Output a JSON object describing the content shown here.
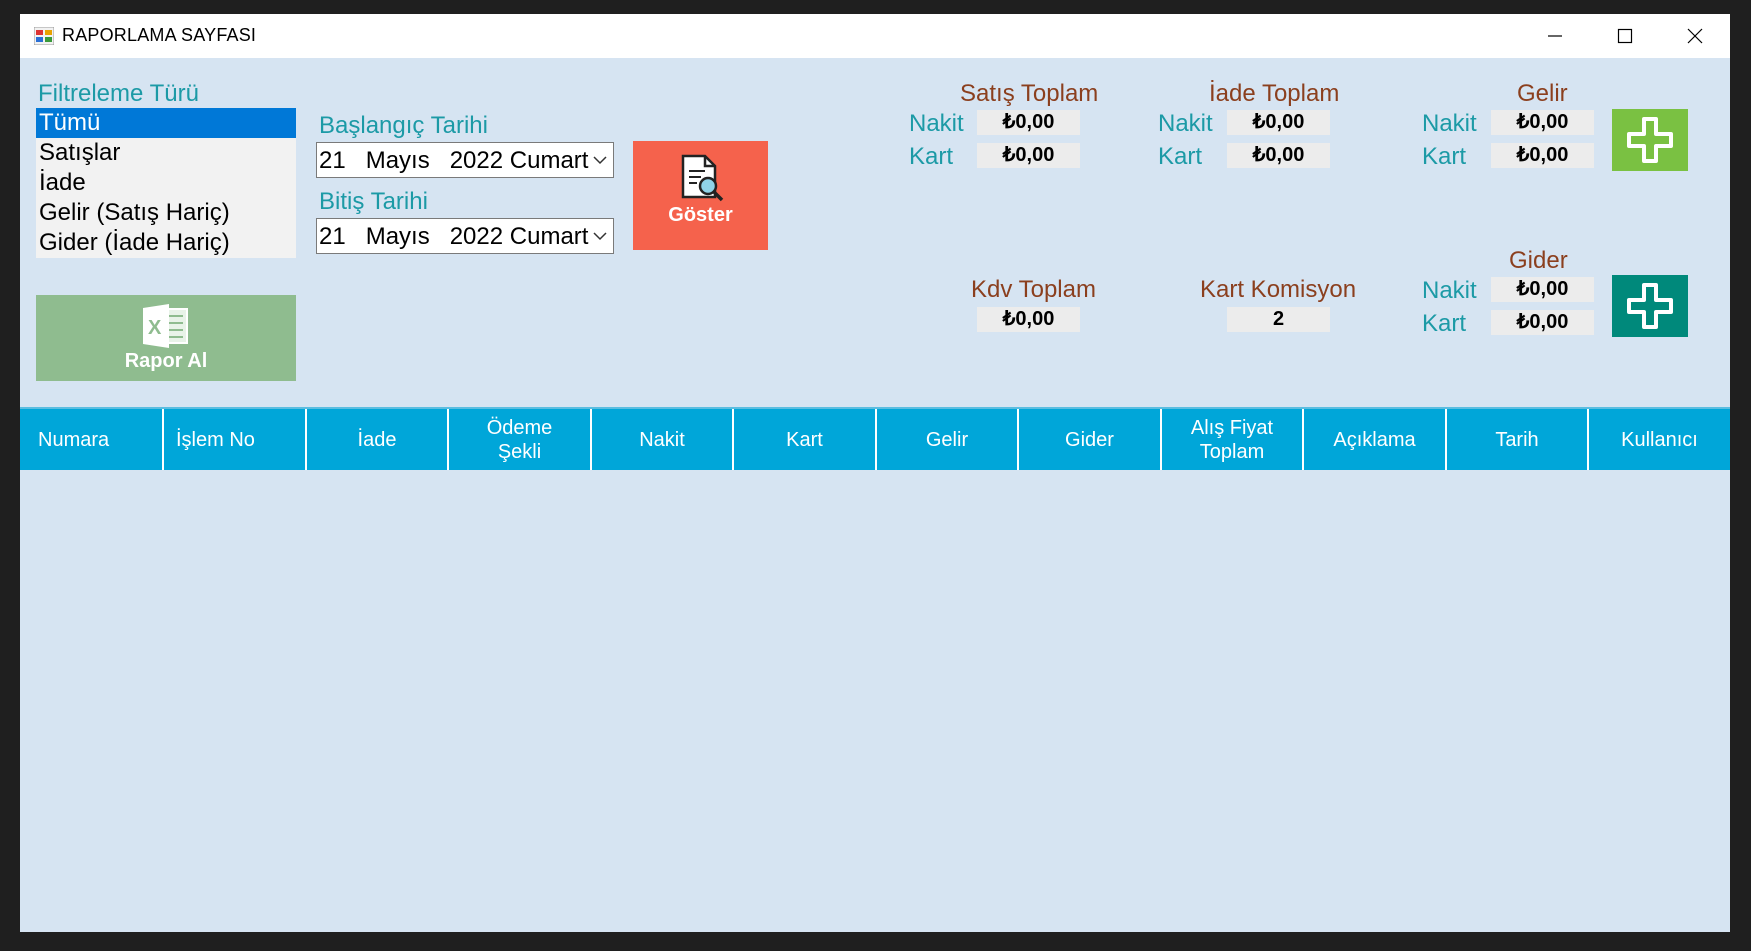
{
  "window": {
    "title": "RAPORLAMA SAYFASI"
  },
  "filter": {
    "label": "Filtreleme Türü",
    "items": [
      "Tümü",
      "Satışlar",
      "İade",
      "Gelir (Satış Hariç)",
      "Gider (İade Hariç)"
    ],
    "selected": "Tümü"
  },
  "start_date": {
    "label": "Başlangıç Tarihi",
    "value": "21   Mayıs   2022 Cumartesi"
  },
  "end_date": {
    "label": "Bitiş Tarihi",
    "value": "21   Mayıs   2022 Cumartesi"
  },
  "show_button": {
    "label": "Göster"
  },
  "report_button": {
    "label": "Rapor Al"
  },
  "sales_total": {
    "title": "Satış Toplam",
    "cash_label": "Nakit",
    "cash_value": "₺0,00",
    "card_label": "Kart",
    "card_value": "₺0,00"
  },
  "return_total": {
    "title": "İade Toplam",
    "cash_label": "Nakit",
    "cash_value": "₺0,00",
    "card_label": "Kart",
    "card_value": "₺0,00"
  },
  "income": {
    "title": "Gelir",
    "cash_label": "Nakit",
    "cash_value": "₺0,00",
    "card_label": "Kart",
    "card_value": "₺0,00"
  },
  "expense": {
    "title": "Gider",
    "cash_label": "Nakit",
    "cash_value": "₺0,00",
    "card_label": "Kart",
    "card_value": "₺0,00"
  },
  "vat_total": {
    "title": "Kdv Toplam",
    "value": "₺0,00"
  },
  "card_commission": {
    "title": "Kart Komisyon",
    "value": "2"
  },
  "table": {
    "columns": [
      "Numara",
      "İşlem No",
      "İade",
      "Ödeme Şekli",
      "Nakit",
      "Kart",
      "Gelir",
      "Gider",
      "Alış Fiyat Toplam",
      "Açıklama",
      "Tarih",
      "Kullanıcı"
    ]
  },
  "colors": {
    "header_bg": "#00a6d9",
    "show_button": "#f5624c",
    "report_button": "#8fbc8f",
    "income_add": "#7ac142",
    "expense_add": "#00897b",
    "selection": "#0078d7"
  }
}
